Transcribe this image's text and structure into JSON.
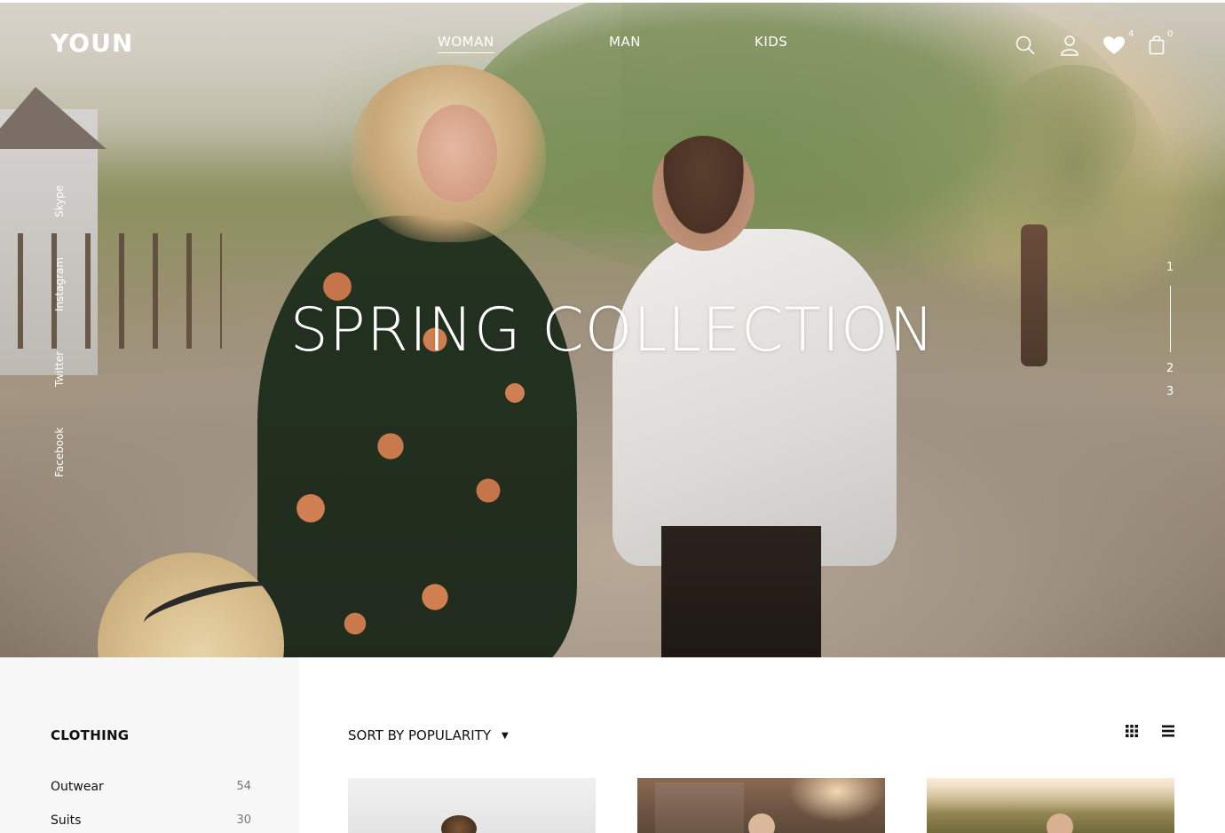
{
  "brand": {
    "logo": "YOUN"
  },
  "nav": {
    "items": [
      {
        "label": "WOMAN",
        "active": true
      },
      {
        "label": "MAN",
        "active": false
      },
      {
        "label": "KIDS",
        "active": false
      }
    ]
  },
  "header_icons": {
    "search": "search-icon",
    "account": "user-icon",
    "wishlist": "heart-icon",
    "wishlist_count": "4",
    "cart": "shopping-bag-icon",
    "cart_count": "0"
  },
  "hero": {
    "headline": "SPRING COLLECTION",
    "slides": [
      "1",
      "2",
      "3"
    ],
    "active_slide": "1"
  },
  "social": {
    "links": [
      "Skype",
      "Instagram",
      "Twitter",
      "Facebook"
    ]
  },
  "sidebar": {
    "title": "CLOTHING",
    "categories": [
      {
        "name": "Outwear",
        "count": "54"
      },
      {
        "name": "Suits",
        "count": "30"
      }
    ]
  },
  "toolbar": {
    "sort_label": "SORT BY POPULARITY",
    "sort_caret": "▼",
    "grid_view": "grid-view-icon",
    "list_view": "list-view-icon"
  },
  "colors": {
    "accent": "#ffffff",
    "text": "#111111",
    "muted": "#777777",
    "sidebar_bg": "#f7f7f7"
  }
}
